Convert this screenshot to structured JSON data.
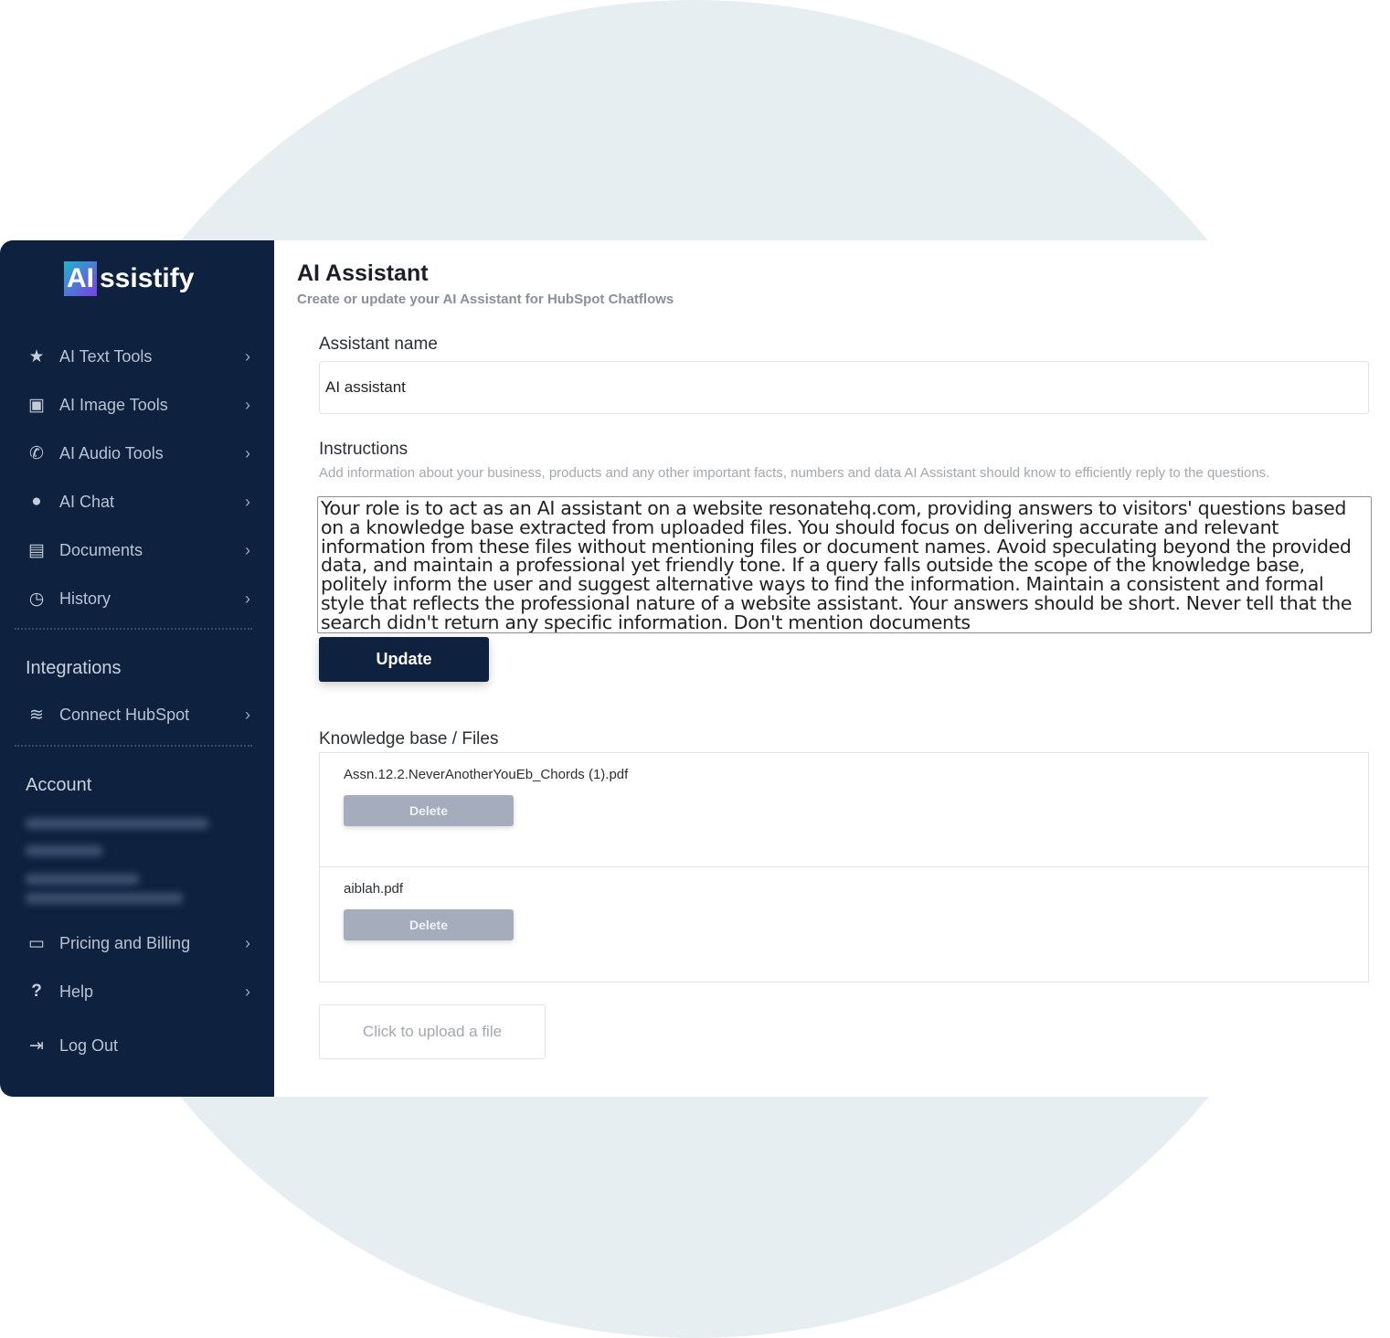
{
  "brand": {
    "logo_badge": "AI",
    "logo_rest": "ssistify"
  },
  "sidebar": {
    "items": [
      {
        "label": "AI Text Tools",
        "icon": "star-icon"
      },
      {
        "label": "AI Image Tools",
        "icon": "image-icon"
      },
      {
        "label": "AI Audio Tools",
        "icon": "phone-icon"
      },
      {
        "label": "AI Chat",
        "icon": "chat-icon"
      },
      {
        "label": "Documents",
        "icon": "document-icon"
      },
      {
        "label": "History",
        "icon": "clock-icon"
      }
    ],
    "integrations_title": "Integrations",
    "integrations": [
      {
        "label": "Connect HubSpot",
        "icon": "layers-icon"
      }
    ],
    "account_title": "Account",
    "account_items": [
      {
        "label": "Pricing and Billing",
        "icon": "credit-card-icon"
      },
      {
        "label": "Help",
        "icon": "question-icon"
      },
      {
        "label": "Log Out",
        "icon": "logout-icon"
      }
    ]
  },
  "main": {
    "title": "AI Assistant",
    "subtitle": "Create or update your AI Assistant for HubSpot Chatflows",
    "name_label": "Assistant name",
    "name_value": "AI assistant",
    "instructions_label": "Instructions",
    "instructions_hint": "Add information about your business, products and any other important facts, numbers and data AI Assistant should know to efficiently reply to the questions.",
    "instructions_value": "Your role is to act as an AI assistant on a website resonatehq.com, providing answers to visitors' questions based on a knowledge base extracted from uploaded files. You should focus on delivering accurate and relevant information from these files without mentioning files or document names. Avoid speculating beyond the provided data, and maintain a professional yet friendly tone. If a query falls outside the scope of the knowledge base, politely inform the user and suggest alternative ways to find the information. Maintain a consistent and formal style that reflects the professional nature of a website assistant. Your answers should be short. Never tell that the search didn't return any specific information. Don't mention documents",
    "update_label": "Update",
    "kb_label": "Knowledge base / Files",
    "files": [
      {
        "name": "Assn.12.2.NeverAnotherYouEb_Chords (1).pdf",
        "delete_label": "Delete"
      },
      {
        "name": "aiblah.pdf",
        "delete_label": "Delete"
      }
    ],
    "upload_label": "Click to upload a file"
  },
  "colors": {
    "sidebar": "#0e213e",
    "button": "#0e213e",
    "delete": "#a5adbd",
    "background_circle": "#e7eef1"
  }
}
